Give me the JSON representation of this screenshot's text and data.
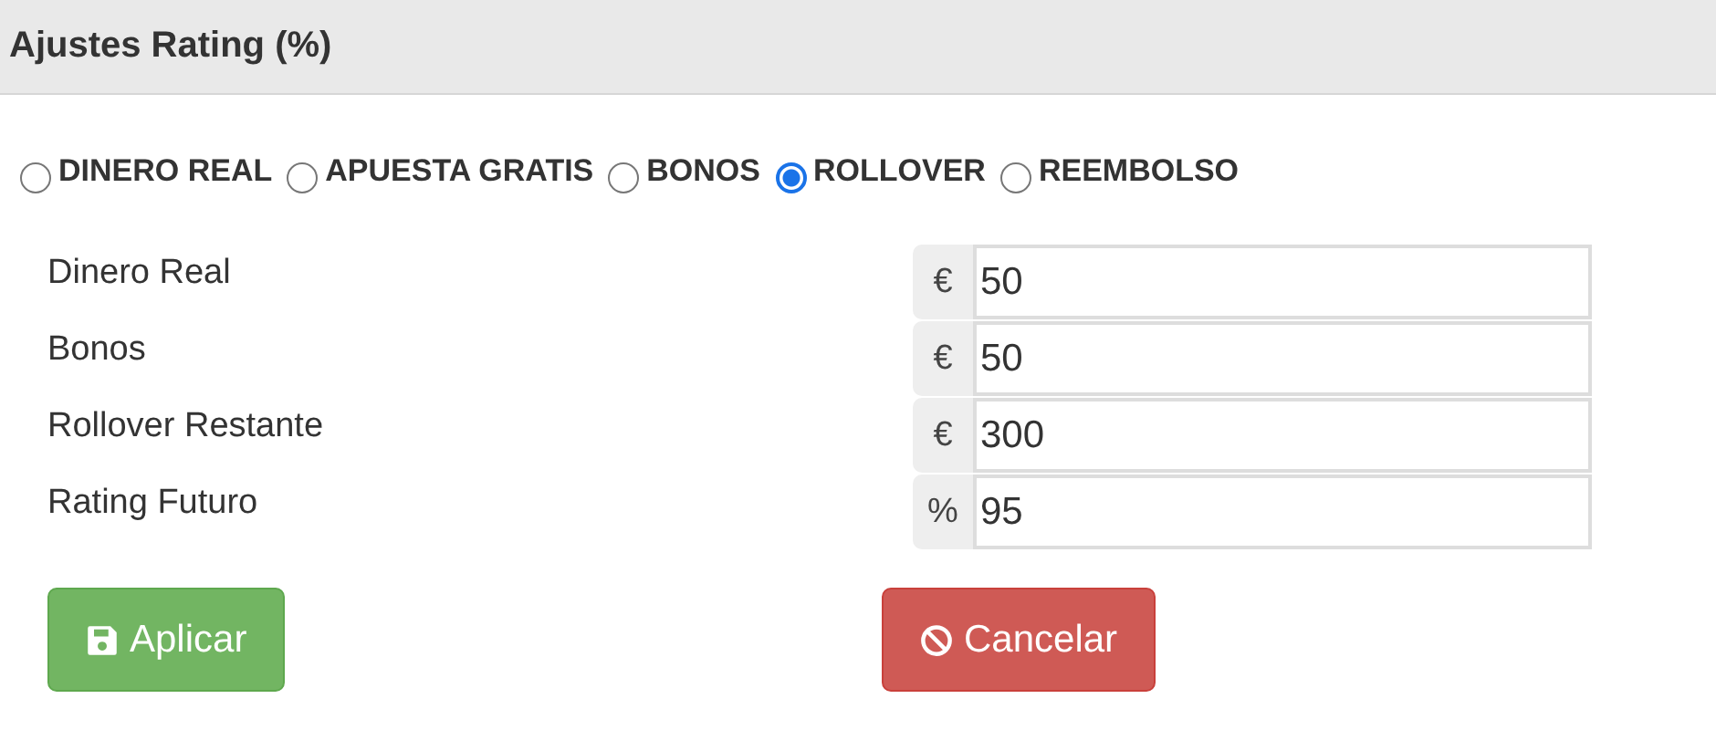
{
  "header": {
    "title": "Ajustes Rating (%)"
  },
  "options": [
    {
      "label": "DINERO REAL",
      "selected": false
    },
    {
      "label": "APUESTA GRATIS",
      "selected": false
    },
    {
      "label": "BONOS",
      "selected": false
    },
    {
      "label": "ROLLOVER",
      "selected": true
    },
    {
      "label": "REEMBOLSO",
      "selected": false
    }
  ],
  "fields": [
    {
      "label": "Dinero Real",
      "addon": "€",
      "value": "50"
    },
    {
      "label": "Bonos",
      "addon": "€",
      "value": "50"
    },
    {
      "label": "Rollover Restante",
      "addon": "€",
      "value": "300"
    },
    {
      "label": "Rating Futuro",
      "addon": "%",
      "value": "95"
    }
  ],
  "buttons": [
    {
      "kind": "apply",
      "label": "Aplicar"
    },
    {
      "kind": "cancel",
      "label": "Cancelar"
    }
  ]
}
